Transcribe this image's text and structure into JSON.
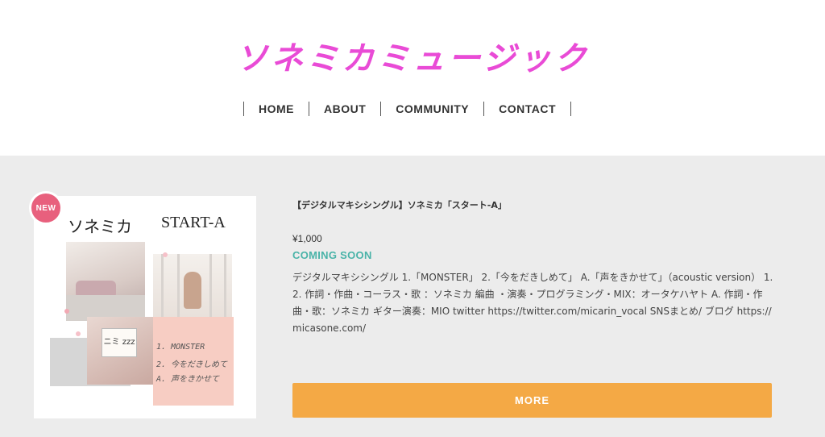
{
  "site": {
    "logo_text": "ソネミカミュージック"
  },
  "nav": {
    "items": [
      {
        "label": "HOME"
      },
      {
        "label": "ABOUT"
      },
      {
        "label": "COMMUNITY"
      },
      {
        "label": "CONTACT"
      }
    ]
  },
  "product": {
    "badge": "NEW",
    "title": "【デジタルマキシシングル】ソネミカ「スタート-A」",
    "price": "¥1,000",
    "status": "COMING SOON",
    "description": "デジタルマキシシングル 1.「MONSTER」 2.「今をだきしめて」 A.「声をきかせて」（acoustic version） 1. 2. 作詞・作曲・コーラス・歌 ：ソネミカ 編曲 ・演奏・プログラミング・MIX：オータケハヤト A. 作詞・作曲・歌：ソネミカ ギター演奏：MIO twitter https://twitter.com/micarin_vocal SNSまとめ/ ブログ https://micasone.com/",
    "more_label": "MORE",
    "cover": {
      "artist": "ソネミカ",
      "title": "START-A",
      "card_text": "ニミ zzz",
      "tracks": [
        "1. MONSTER",
        "2. 今をだきしめて",
        "A. 声をきかせて"
      ]
    }
  },
  "colors": {
    "logo": "#e94bd6",
    "badge": "#e8607d",
    "status": "#49b3a8",
    "button": "#f4a945",
    "main_bg": "#ececec"
  }
}
